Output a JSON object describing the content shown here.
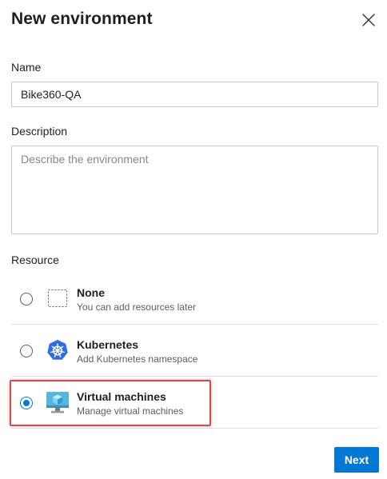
{
  "dialog": {
    "title": "New environment"
  },
  "name_field": {
    "label": "Name",
    "value": "Bike360-QA"
  },
  "description_field": {
    "label": "Description",
    "value": "",
    "placeholder": "Describe the environment"
  },
  "resource": {
    "label": "Resource",
    "options": [
      {
        "title": "None",
        "subtitle": "You can add resources later",
        "icon": "dashed-square-icon",
        "selected": false
      },
      {
        "title": "Kubernetes",
        "subtitle": "Add Kubernetes namespace",
        "icon": "kubernetes-icon",
        "selected": false
      },
      {
        "title": "Virtual machines",
        "subtitle": "Manage virtual machines",
        "icon": "virtual-machine-icon",
        "selected": true
      }
    ]
  },
  "footer": {
    "next_label": "Next"
  },
  "colors": {
    "accent": "#0078d4",
    "highlight": "#e0464d",
    "kubernetes": "#326ce5"
  }
}
